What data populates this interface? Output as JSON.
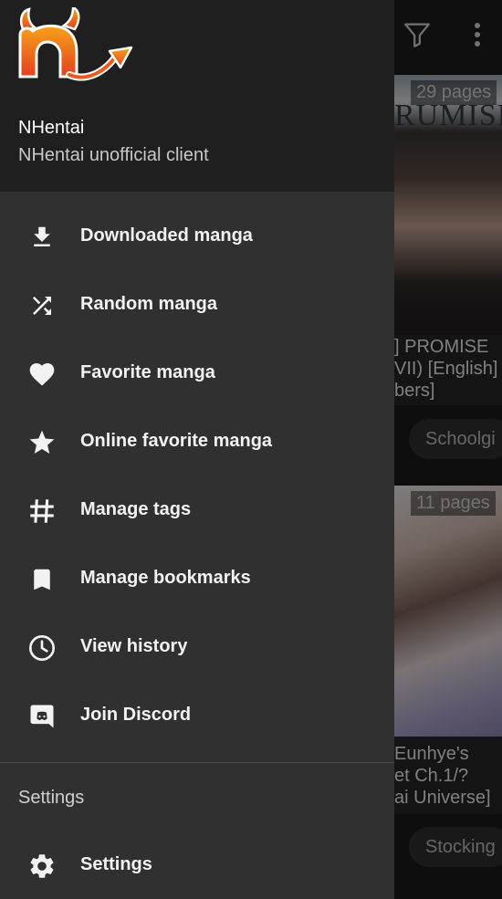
{
  "header": {
    "app_name": "NHentai",
    "app_subtitle": "NHentai unofficial client"
  },
  "menu": {
    "items": [
      {
        "label": "Downloaded manga",
        "icon": "download-icon"
      },
      {
        "label": "Random manga",
        "icon": "shuffle-icon"
      },
      {
        "label": "Favorite manga",
        "icon": "heart-icon"
      },
      {
        "label": "Online favorite manga",
        "icon": "star-icon"
      },
      {
        "label": "Manage tags",
        "icon": "hashtag-icon"
      },
      {
        "label": "Manage bookmarks",
        "icon": "bookmark-icon"
      },
      {
        "label": "View history",
        "icon": "clock-icon"
      },
      {
        "label": "Join Discord",
        "icon": "discord-icon"
      }
    ],
    "section_title": "Settings",
    "settings_label": "Settings"
  },
  "background": {
    "cards": [
      {
        "pages": "29 pages",
        "title_lines": [
          "] PROMISE",
          "VII) [English]",
          "bers]"
        ],
        "cover_text": "RUMISE",
        "chip": "Schoolgi"
      },
      {
        "pages": "11 pages",
        "title_lines": [
          "Eunhye's",
          "et Ch.1/?",
          "ai Universe]"
        ],
        "chip": "Stocking"
      }
    ]
  },
  "colors": {
    "drawer_bg": "#303030",
    "header_bg": "#1f1f1f",
    "logo_orange": "#e8541c",
    "text_primary": "#f2f2f2"
  }
}
